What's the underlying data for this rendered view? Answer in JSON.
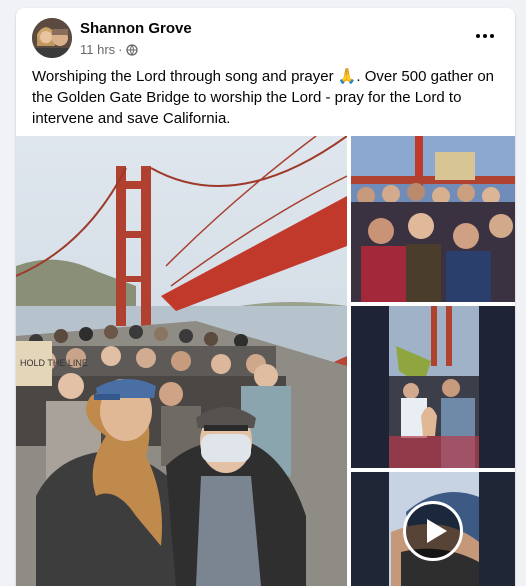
{
  "post": {
    "author": "Shannon Grove",
    "time": "11 hrs",
    "separator": "·",
    "privacy_icon": "globe-icon",
    "more_icon": "more-options-icon",
    "text": "Worshiping the Lord through song and prayer 🙏. Over 500 gather on the Golden Gate Bridge to worship the Lord - pray for the Lord to intervene and save California."
  },
  "photos": {
    "sign_text": "HOLD THE LINE"
  },
  "colors": {
    "bridge_orange": "#c0392b",
    "facebook_text": "#050505",
    "secondary_text": "#65676b"
  }
}
